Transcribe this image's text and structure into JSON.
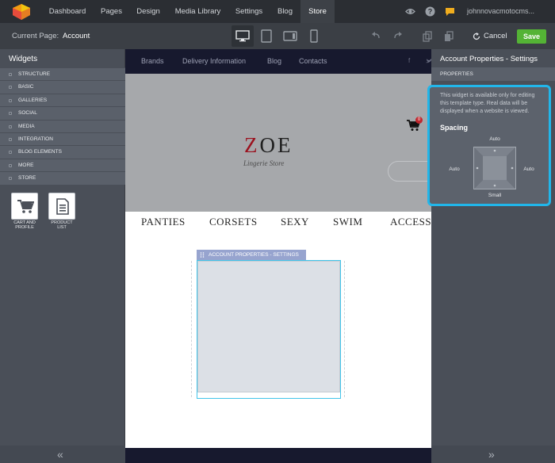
{
  "topbar": {
    "nav": [
      "Dashboard",
      "Pages",
      "Design",
      "Media Library",
      "Settings",
      "Blog",
      "Store"
    ],
    "active_nav": "Store",
    "user": "johnnovacmotocms..."
  },
  "toolbar": {
    "current_page_label": "Current Page:",
    "current_page_value": "Account",
    "cancel_label": "Cancel",
    "save_label": "Save"
  },
  "left_panel": {
    "title": "Widgets",
    "categories": [
      "STRUCTURE",
      "BASIC",
      "GALLERIES",
      "SOCIAL",
      "MEDIA",
      "INTEGRATION",
      "BLOG ELEMENTS",
      "MORE",
      "STORE"
    ],
    "widgets": [
      {
        "label_line1": "CART AND",
        "label_line2": "PROFILE",
        "icon": "shopping-cart-icon"
      },
      {
        "label_line1": "PRODUCT",
        "label_line2": "LIST",
        "icon": "document-list-icon"
      }
    ]
  },
  "site": {
    "nav_links": [
      "Brands",
      "Delivery Information",
      "Blog",
      "Contacts"
    ],
    "brand_z": "Z",
    "brand_rest": "OE",
    "tagline": "Lingerie Store",
    "cart_count": "0",
    "menu": [
      "PANTIES",
      "CORSETS",
      "SEXY",
      "SWIM",
      "ACCESSO"
    ],
    "widget_tag": "ACCOUNT PROPERTIES - SETTINGS"
  },
  "right_panel": {
    "title": "Account Properties - Settings",
    "tab": "PROPERTIES",
    "notice": "This widget is available only for editing this template type. Real data will be displayed when a website is viewed.",
    "spacing_title": "Spacing",
    "spacing": {
      "top": "Auto",
      "left": "Auto",
      "right": "Auto",
      "bottom": "Small"
    }
  },
  "colors": {
    "accent_blue": "#21b6ea",
    "save_green": "#54b335",
    "brand_red": "#9b111e"
  }
}
